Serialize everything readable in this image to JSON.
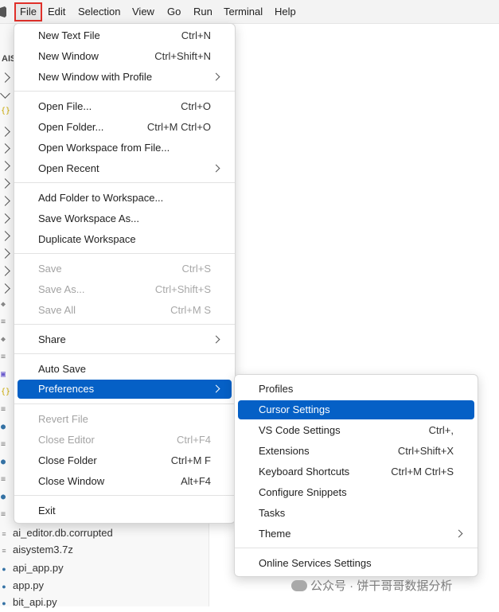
{
  "menubar": {
    "items": [
      "File",
      "Edit",
      "Selection",
      "View",
      "Go",
      "Run",
      "Terminal",
      "Help"
    ]
  },
  "sidebar": {
    "title": "AIS",
    "files": [
      "ai_editor.db.corrupted",
      "aisystem3.7z",
      "api_app.py",
      "app.py",
      "bit_api.py"
    ]
  },
  "file_menu": {
    "items": [
      {
        "label": "New Text File",
        "shortcut": "Ctrl+N"
      },
      {
        "label": "New Window",
        "shortcut": "Ctrl+Shift+N"
      },
      {
        "label": "New Window with Profile",
        "shortcut": ""
      },
      {
        "label": "Open File...",
        "shortcut": "Ctrl+O"
      },
      {
        "label": "Open Folder...",
        "shortcut": "Ctrl+M Ctrl+O"
      },
      {
        "label": "Open Workspace from File...",
        "shortcut": ""
      },
      {
        "label": "Open Recent",
        "shortcut": ""
      },
      {
        "label": "Add Folder to Workspace...",
        "shortcut": ""
      },
      {
        "label": "Save Workspace As...",
        "shortcut": ""
      },
      {
        "label": "Duplicate Workspace",
        "shortcut": ""
      },
      {
        "label": "Save",
        "shortcut": "Ctrl+S"
      },
      {
        "label": "Save As...",
        "shortcut": "Ctrl+Shift+S"
      },
      {
        "label": "Save All",
        "shortcut": "Ctrl+M S"
      },
      {
        "label": "Share",
        "shortcut": ""
      },
      {
        "label": "Auto Save",
        "shortcut": ""
      },
      {
        "label": "Preferences",
        "shortcut": ""
      },
      {
        "label": "Revert File",
        "shortcut": ""
      },
      {
        "label": "Close Editor",
        "shortcut": "Ctrl+F4"
      },
      {
        "label": "Close Folder",
        "shortcut": "Ctrl+M F"
      },
      {
        "label": "Close Window",
        "shortcut": "Alt+F4"
      },
      {
        "label": "Exit",
        "shortcut": ""
      }
    ]
  },
  "preferences_menu": {
    "items": [
      {
        "label": "Profiles",
        "shortcut": ""
      },
      {
        "label": "Cursor Settings",
        "shortcut": ""
      },
      {
        "label": "VS Code Settings",
        "shortcut": "Ctrl+,"
      },
      {
        "label": "Extensions",
        "shortcut": "Ctrl+Shift+X"
      },
      {
        "label": "Keyboard Shortcuts",
        "shortcut": "Ctrl+M Ctrl+S"
      },
      {
        "label": "Configure Snippets",
        "shortcut": ""
      },
      {
        "label": "Tasks",
        "shortcut": ""
      },
      {
        "label": "Theme",
        "shortcut": ""
      },
      {
        "label": "Online Services Settings",
        "shortcut": ""
      }
    ]
  },
  "watermark": {
    "text": "公众号 · 饼干哥哥数据分析"
  },
  "colors": {
    "highlight": "#0560c6",
    "file_outline": "#e0302a"
  }
}
